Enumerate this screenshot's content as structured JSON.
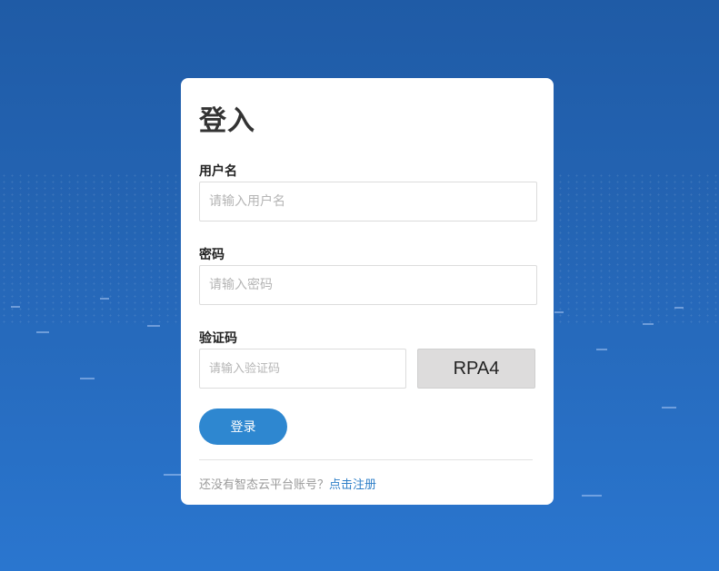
{
  "login": {
    "title": "登入",
    "username": {
      "label": "用户名",
      "placeholder": "请输入用户名",
      "value": ""
    },
    "password": {
      "label": "密码",
      "placeholder": "请输入密码",
      "value": ""
    },
    "captcha": {
      "label": "验证码",
      "placeholder": "请输入验证码",
      "value": "",
      "image_text": "RPA4"
    },
    "submit_label": "登录",
    "footer": {
      "prompt": "还没有智态云平台账号？",
      "register_link": "点击注册"
    }
  },
  "colors": {
    "background_top": "#1f5ba6",
    "background_bottom": "#2a76cf",
    "button": "#2e87d0",
    "link": "#2e7fc8"
  }
}
